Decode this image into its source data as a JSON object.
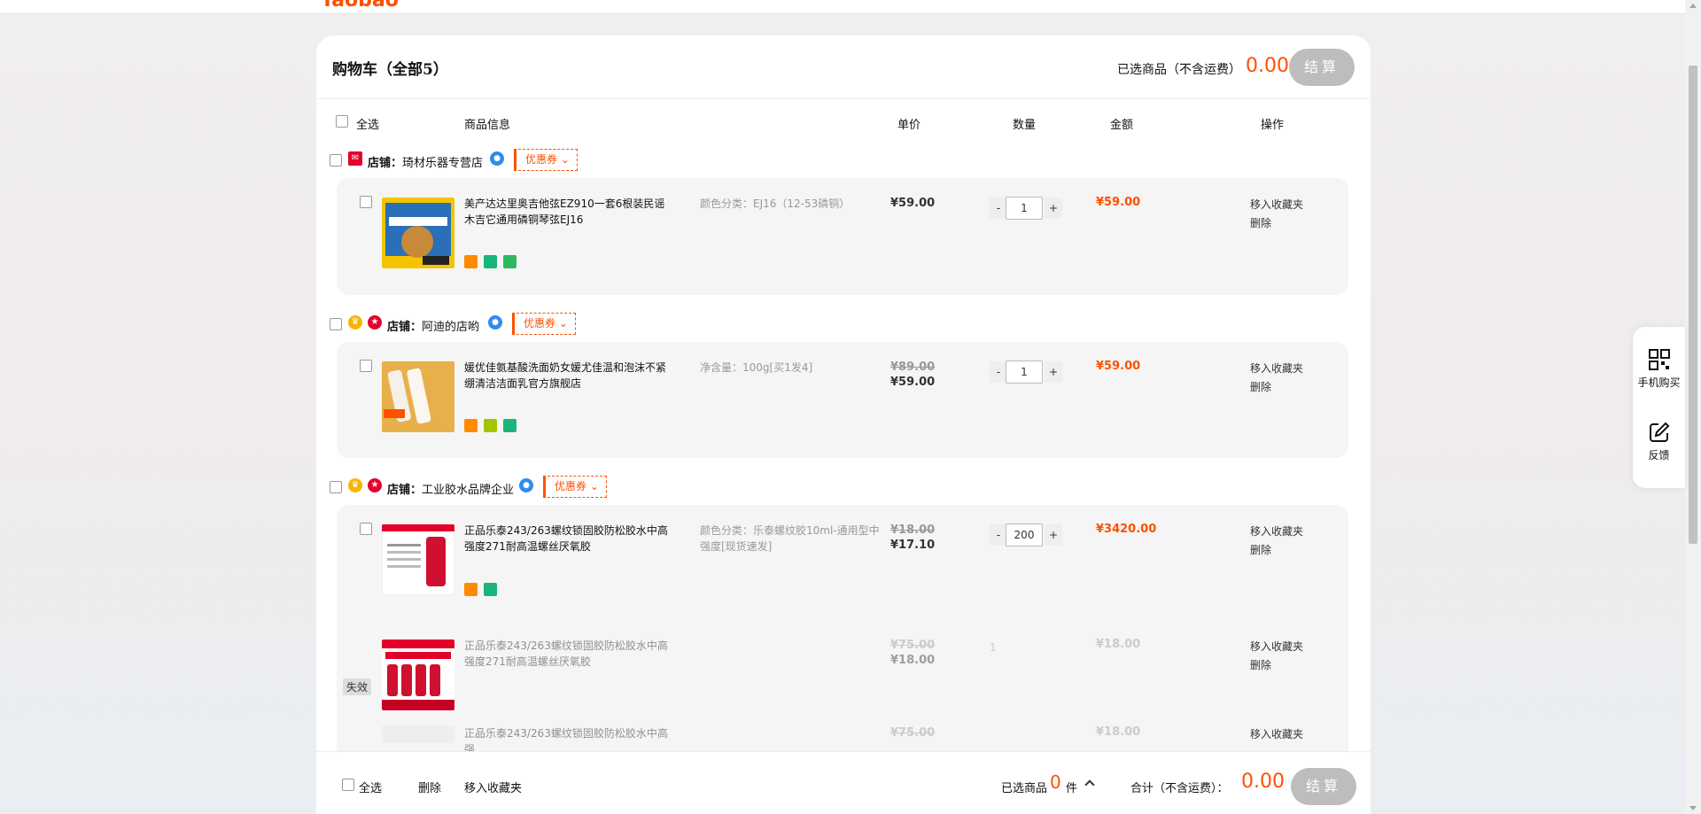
{
  "topbar": {
    "logo": "Taobao"
  },
  "header": {
    "title": "购物车（全部5）",
    "selected_label": "已选商品（不含运费）",
    "selected_amount": "0.00",
    "settle_label": "结算"
  },
  "columns": {
    "select_all": "全选",
    "product_info": "商品信息",
    "unit_price": "单价",
    "quantity": "数量",
    "amount": "金额",
    "actions": "操作"
  },
  "shops": [
    {
      "shop_prefix": "店铺：",
      "shop_name": "琦材乐器专营店",
      "coupon": "优惠券",
      "items": [
        {
          "title": "美产达达里奥吉他弦EZ910一套6根装民谣木吉它通用磷铜琴弦EJ16",
          "spec": "颜色分类：EJ16（12-53磷铜）",
          "orig_price": "",
          "price": "¥59.00",
          "qty": "1",
          "amount": "¥59.00",
          "op_fav": "移入收藏夹",
          "op_del": "删除"
        }
      ]
    },
    {
      "shop_prefix": "店铺：",
      "shop_name": "阿迪的店哟",
      "coupon": "优惠券",
      "items": [
        {
          "title": "媛优佳氨基酸洗面奶女媛尤佳温和泡沫不紧绷清洁洁面乳官方旗舰店",
          "spec": "净含量：100g[买1发4]",
          "orig_price": "¥89.00",
          "price": "¥59.00",
          "qty": "1",
          "amount": "¥59.00",
          "op_fav": "移入收藏夹",
          "op_del": "删除"
        }
      ]
    },
    {
      "shop_prefix": "店铺：",
      "shop_name": "工业胶水品牌企业",
      "coupon": "优惠券",
      "items": [
        {
          "title": "正品乐泰243/263螺纹锁固胶防松胶水中高强度271耐高温螺丝厌氧胶",
          "spec": "颜色分类：乐泰螺纹胶10ml-通用型中强度[现货速发]",
          "orig_price": "¥18.00",
          "price": "¥17.10",
          "qty": "200",
          "amount": "¥3420.00",
          "op_fav": "移入收藏夹",
          "op_del": "删除"
        },
        {
          "title": "正品乐泰243/263螺纹锁固胶防松胶水中高强度271耐高温螺丝厌氧胶",
          "spec": "",
          "orig_price": "¥75.00",
          "price": "¥18.00",
          "qty": "1",
          "amount": "¥18.00",
          "op_fav": "移入收藏夹",
          "op_del": "删除",
          "invalid": "失效"
        },
        {
          "title": "正品乐泰243/263螺纹锁固胶防松胶水中高强",
          "spec": "",
          "orig_price": "¥75.00",
          "price": "",
          "qty": "",
          "amount": "¥18.00",
          "op_fav": "移入收藏夹",
          "op_del": ""
        }
      ]
    }
  ],
  "footer": {
    "select_all": "全选",
    "delete": "删除",
    "move_fav": "移入收藏夹",
    "selected_prefix": "已选商品",
    "selected_count": "0",
    "unit": "件",
    "total_label": "合计（不含运费）：",
    "total_amount": "0.00",
    "settle_label": "结算"
  },
  "side_panel": {
    "mobile_buy": "手机购买",
    "feedback": "反馈"
  },
  "colors": {
    "accent": "#ff5000",
    "settle_disabled": "#bdbdbd"
  }
}
